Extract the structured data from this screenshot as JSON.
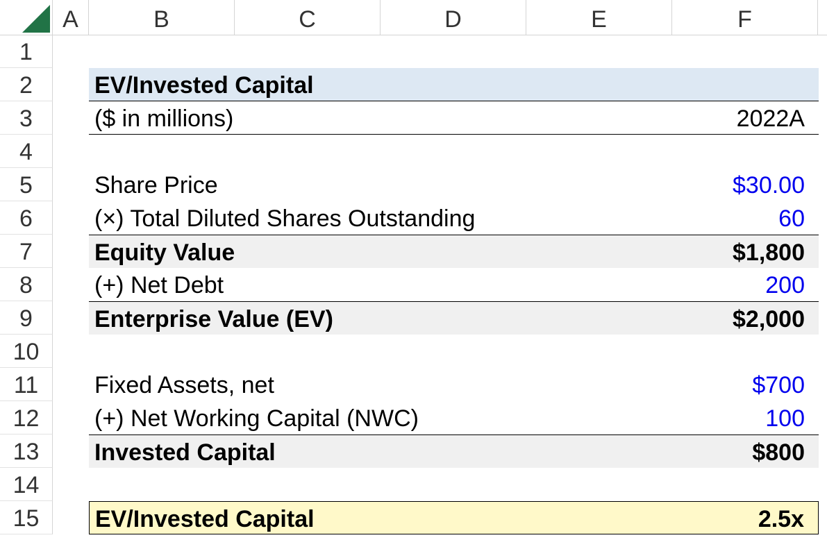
{
  "columns": [
    "A",
    "B",
    "C",
    "D",
    "E",
    "F"
  ],
  "rows": [
    "1",
    "2",
    "3",
    "4",
    "5",
    "6",
    "7",
    "8",
    "9",
    "10",
    "11",
    "12",
    "13",
    "14",
    "15"
  ],
  "table": {
    "title": "EV/Invested Capital",
    "units": "($ in millions)",
    "period": "2022A",
    "share_price_label": "Share Price",
    "share_price_value": "$30.00",
    "shares_label": "(×) Total Diluted Shares Outstanding",
    "shares_value": "60",
    "equity_label": "Equity Value",
    "equity_value": "$1,800",
    "net_debt_label": "(+) Net Debt",
    "net_debt_value": "200",
    "ev_label": "Enterprise Value (EV)",
    "ev_value": "$2,000",
    "fixed_assets_label": "Fixed Assets, net",
    "fixed_assets_value": "$700",
    "nwc_label": "(+) Net Working Capital (NWC)",
    "nwc_value": "100",
    "invested_capital_label": "Invested Capital",
    "invested_capital_value": "$800",
    "multiple_label": "EV/Invested Capital",
    "multiple_value": "2.5x"
  },
  "colors": {
    "input_blue": "#0000ee",
    "title_fill": "#dde8f3",
    "total_fill": "#f0f0f0",
    "result_fill": "#fff9c9",
    "corner_green": "#217346"
  }
}
